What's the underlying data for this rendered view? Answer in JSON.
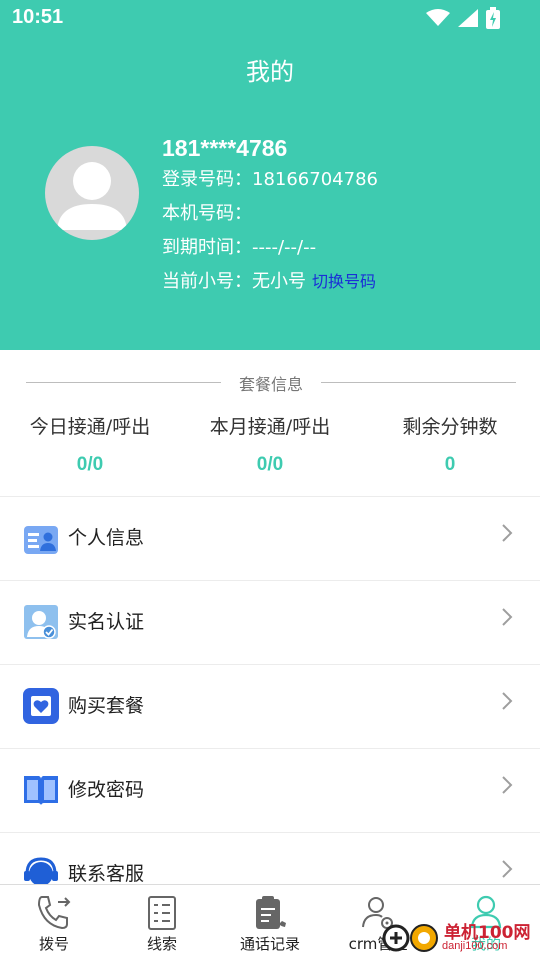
{
  "status_bar": {
    "time": "10:51",
    "icons": [
      "wifi-icon",
      "signal-icon",
      "battery-charging-icon"
    ]
  },
  "header": {
    "title": "我的",
    "accent_color": "#3ecbb0"
  },
  "profile": {
    "masked_phone": "181****4786",
    "login_label": "登录号码：",
    "login_value": "18166704786",
    "local_label": "本机号码：",
    "local_value": "",
    "expire_label": "到期时间：",
    "expire_value": "----/--/--",
    "current_label": "当前小号：",
    "current_value": "无小号",
    "switch_label": "切换号码",
    "switch_color": "#1a2fd6"
  },
  "package": {
    "title": "套餐信息",
    "stats": [
      {
        "label": "今日接通/呼出",
        "value": "0/0"
      },
      {
        "label": "本月接通/呼出",
        "value": "0/0"
      },
      {
        "label": "剩余分钟数",
        "value": "0"
      }
    ]
  },
  "menu": [
    {
      "label": "个人信息",
      "icon": "id-card-icon"
    },
    {
      "label": "实名认证",
      "icon": "verified-user-icon"
    },
    {
      "label": "购买套餐",
      "icon": "heart-shop-icon"
    },
    {
      "label": "修改密码",
      "icon": "book-icon"
    },
    {
      "label": "联系客服",
      "icon": "headset-icon"
    }
  ],
  "bottom_nav": [
    {
      "label": "拨号",
      "icon": "phone-forward-icon",
      "active": false
    },
    {
      "label": "线索",
      "icon": "clue-list-icon",
      "active": false
    },
    {
      "label": "通话记录",
      "icon": "call-log-icon",
      "active": false
    },
    {
      "label": "crm管理",
      "icon": "user-gear-icon",
      "active": false
    },
    {
      "label": "我的",
      "icon": "user-icon",
      "active": true
    }
  ],
  "watermark": {
    "text": "单机100网",
    "sub": "danji100.com"
  }
}
